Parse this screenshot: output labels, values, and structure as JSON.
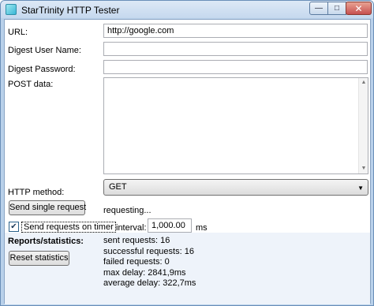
{
  "window": {
    "title": "StarTrinity HTTP Tester"
  },
  "form": {
    "url_label": "URL:",
    "url_value": "http://google.com",
    "user_label": "Digest User Name:",
    "user_value": "",
    "password_label": "Digest Password:",
    "password_value": "",
    "post_label": "POST data:",
    "post_value": "",
    "method_label": "HTTP method:",
    "method_value": "GET"
  },
  "actions": {
    "send_single_label": "Send single request",
    "status_text": "requesting...",
    "timer_checkbox_label": "Send requests on timer",
    "timer_checked": true,
    "interval_label": "interval:",
    "interval_value": "1,000.00",
    "interval_unit": "ms"
  },
  "reports": {
    "heading": "Reports/statistics:",
    "reset_label": "Reset statistics",
    "lines": [
      "sent requests: 16",
      "successful requests: 16",
      "failed requests: 0",
      "max delay: 2841,9ms",
      "average delay: 322,7ms"
    ]
  }
}
